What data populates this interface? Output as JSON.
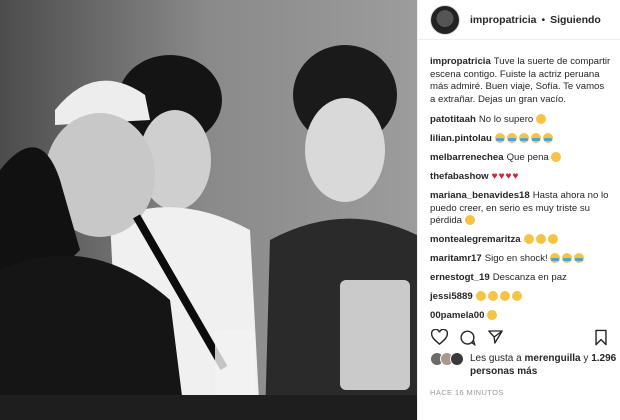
{
  "header": {
    "username": "impropatricia",
    "separator": "•",
    "follow_status": "Siguiendo"
  },
  "caption": {
    "username": "impropatricia",
    "text": "Tuve la suerte de compartir escena contigo. Fuiste la actriz peruana más admiré. Buen viaje, Sofía. Te vamos a extrañar. Dejas un gran vacío."
  },
  "comments": [
    {
      "username": "patotitaah",
      "text": "No lo supero",
      "emojis": [
        "sad"
      ]
    },
    {
      "username": "lilian.pintolau",
      "text": "",
      "emojis": [
        "cry",
        "cry",
        "cry",
        "cry",
        "cry"
      ]
    },
    {
      "username": "melbarrenechea",
      "text": "Que pena",
      "emojis": [
        "sad"
      ]
    },
    {
      "username": "thefabashow",
      "text": "",
      "emojis": [
        "heart",
        "heart",
        "heart",
        "heart"
      ]
    },
    {
      "username": "mariana_benavides18",
      "text": "Hasta ahora no lo puedo creer, en serio es muy triste su pérdida",
      "emojis": [
        "sad"
      ]
    },
    {
      "username": "montealegremaritza",
      "text": "",
      "emojis": [
        "sad",
        "sad",
        "sad"
      ]
    },
    {
      "username": "maritamr17",
      "text": "Sigo en shock!",
      "emojis": [
        "cry",
        "cry",
        "cry"
      ]
    },
    {
      "username": "ernestogt_19",
      "text": "Descanza en paz",
      "emojis": []
    },
    {
      "username": "jessi5889",
      "text": "",
      "emojis": [
        "sad",
        "sad",
        "sad",
        "sad"
      ]
    },
    {
      "username": "00pamela00",
      "text": "",
      "emojis": [
        "sad"
      ]
    }
  ],
  "likes": {
    "prefix": "Les gusta a ",
    "user": "merenguilla",
    "middle": " y ",
    "count": "1.296 personas más"
  },
  "timestamp": "HACE 16 MINUTOS",
  "icons": [
    "heart-icon",
    "comment-bubble-icon",
    "share-icon",
    "bookmark-icon"
  ],
  "colors": {
    "heart": "#d81f36",
    "emoji": "#f6c445",
    "tear": "#4aa3df",
    "muted": "#999999"
  }
}
